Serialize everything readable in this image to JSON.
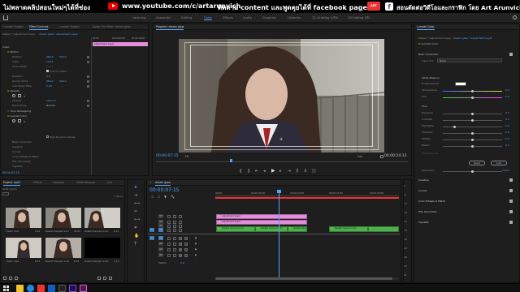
{
  "banner": {
    "left_text": "ไม่พลาดคลิปสอนใหม่ๆได้ที่ช่อง",
    "youtube_url": "www.youtube.com/c/artarunvich",
    "middle_text": "ติดตาม content และพูดคุยได้ที่ facebook page",
    "live_badge": "ART",
    "right_text": "สอนตัดต่อวิดีโอและกราฟิก โดย Art Arunvich"
  },
  "workspace": {
    "tabs": [
      "Learning",
      "Assembly",
      "Editing",
      "Color",
      "Effects",
      "Audio",
      "Graphics",
      "Libraries",
      "22-Grading (ปรับ)",
      "19-Editing ปรับ"
    ],
    "active_tab": "Color"
  },
  "source_panel": {
    "tab_lumetri": "Lumetri Scopes",
    "tab_effect_controls": "Effect Controls",
    "tab_lumetri_scopes": "Lumetri Scopes",
    "tab_audio_mixer": "Audio Clip Mixer: dream glow",
    "breadcrumb_left": "Master * Adjustment Layer",
    "breadcrumb_right": "dream glow * Adjustment Layer",
    "clip_label": "Adjustment Layer",
    "timecodes": [
      "00:00",
      "00:00:05:00",
      "00:00:10:00"
    ]
  },
  "effect_controls": {
    "video_header": "Video",
    "motion": "Motion",
    "position_label": "Position",
    "position_x": "960.0",
    "position_y": "540.0",
    "scale_label": "Scale",
    "scale_value": "100.0",
    "scale_width_label": "Scale Width",
    "scale_width_value": "100.0",
    "uniform_scale_label": "Uniform Scale",
    "rotation_label": "Rotation",
    "rotation_value": "0.0",
    "anchor_label": "Anchor Point",
    "anchor_x": "960.0",
    "anchor_y": "540.0",
    "anti_flicker_label": "Anti-flicker Filter",
    "anti_flicker_value": "0.00",
    "opacity_header": "Opacity",
    "opacity_label": "Opacity",
    "opacity_value": "100.0 %",
    "blend_label": "Blend Mode",
    "blend_value": "Normal",
    "time_remapping": "Time Remapping",
    "lumetri_color": "Lumetri Color",
    "high_dynamic_range": "High Dynamic Range",
    "basic_correction": "Basic Correction",
    "creative": "Creative",
    "curves": "Curves",
    "color_wheels": "Color Wheels & Match",
    "hsl_secondary": "HSL Secondary",
    "vignette": "Vignette",
    "current_time": "00:00:07:15"
  },
  "program": {
    "title": "Program: dream glow",
    "current_tc": "00:00:07:15",
    "fit_label": "Fit",
    "full_label": "Full",
    "duration_tc": "00:00:24:13"
  },
  "project": {
    "tab_project": "Project: ep02",
    "tab_effects": "Effects",
    "tab_libraries": "Libraries",
    "tab_media_browser": "Media Browser",
    "tab_info": "Info",
    "path": "ep02.prproj",
    "item_count": "7 Items",
    "items": [
      {
        "name": "dream.mp4",
        "duration": "6:26"
      },
      {
        "name": "Nested Sequence 01",
        "duration": "25:03"
      },
      {
        "name": "Nested Sequence 02",
        "duration": "6:17"
      },
      {
        "name": "dream.mp4",
        "duration": "6:15"
      },
      {
        "name": "Nested Sequence 03",
        "duration": "6:16"
      },
      {
        "name": "Nested Sequence 04",
        "duration": "4:13"
      }
    ]
  },
  "timeline": {
    "tab_label": "dream glow",
    "current_tc": "00:00:07:15",
    "ruler_ticks": [
      "00:00",
      "00:00:05:00",
      "00:00:10:00",
      "00:00:15:00",
      "00:00:20:00"
    ],
    "tracks": [
      "V4",
      "V3",
      "V2",
      "V1",
      "A1",
      "A2",
      "A3",
      "A4"
    ],
    "source_v": "V1",
    "source_a": "A1",
    "master_label": "Master",
    "master_value": "0.0",
    "clips_v3": "Adjustment Layer",
    "clips_v2": "Adjustment Layer",
    "clips_v1": [
      "Nested Sequence 01",
      "Nested Sequence 01",
      "Nested Sequence 01",
      "Nested Sequence 01"
    ]
  },
  "lumetri": {
    "tab_label": "Lumetri Color",
    "breadcrumb_left": "Master * Adjustment Layer",
    "breadcrumb_right": "dream glow * Adjustment Layer",
    "fx_label": "Lumetri Color",
    "basic_correction": "Basic Correction",
    "input_lut_label": "Input LUT",
    "input_lut_value": "None",
    "white_balance": "White Balance",
    "wb_selector": "WB Selector",
    "temperature_label": "Temperature",
    "temperature_value": "0.0",
    "tint_label": "Tint",
    "tint_value": "0.0",
    "tone": "Tone",
    "exposure_label": "Exposure",
    "exposure_value": "0.0",
    "contrast_label": "Contrast",
    "contrast_value": "0.0",
    "highlights_label": "Highlights",
    "highlights_value": "0.0",
    "shadows_label": "Shadows",
    "shadows_value": "0.0",
    "whites_label": "Whites",
    "whites_value": "0.0",
    "blacks_label": "Blacks",
    "blacks_value": "0.0",
    "hdr_specular_label": "HDR Specular",
    "reset_label": "Reset",
    "auto_label": "Auto",
    "saturation_label": "Saturation",
    "saturation_value": "100.0",
    "creative": "Creative",
    "curves": "Curves",
    "color_wheels": "Color Wheels & Match",
    "hsl_secondary": "HSL Secondary",
    "vignette": "Vignette"
  },
  "audio_meter_labels": [
    "0",
    "-6",
    "-12",
    "-18",
    "-24",
    "-30",
    "-36",
    "-42",
    "-48",
    "-54",
    "dB"
  ],
  "colors": {
    "accent": "#4ea4ff",
    "clip_pink": "#e38ddb",
    "clip_green": "#4db04d",
    "playhead": "#4ea4ff"
  }
}
